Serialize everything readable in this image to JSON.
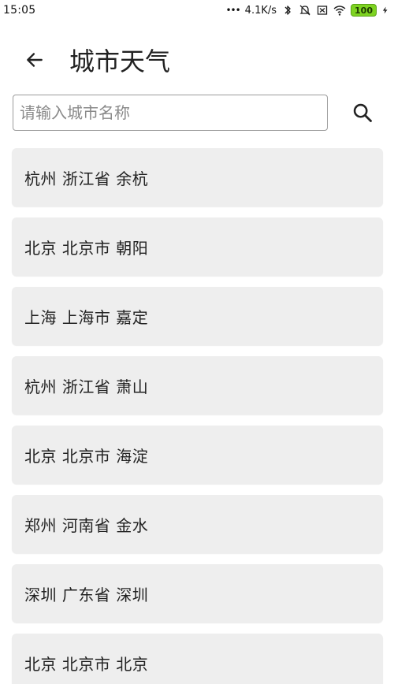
{
  "status_bar": {
    "time": "15:05",
    "network_speed": "4.1K/s",
    "battery": "100",
    "icons": [
      "dots-icon",
      "bluetooth-icon",
      "mute-icon",
      "sim-icon",
      "wifi-icon",
      "battery-icon",
      "charging-icon"
    ]
  },
  "header": {
    "title": "城市天气",
    "back_icon": "back-arrow-icon"
  },
  "search": {
    "placeholder": "请输入城市名称",
    "value": "",
    "button_icon": "search-icon"
  },
  "cities": [
    {
      "label": "杭州 浙江省 余杭"
    },
    {
      "label": "北京 北京市 朝阳"
    },
    {
      "label": "上海 上海市 嘉定"
    },
    {
      "label": "杭州 浙江省 萧山"
    },
    {
      "label": "北京 北京市 海淀"
    },
    {
      "label": "郑州 河南省 金水"
    },
    {
      "label": "深圳 广东省 深圳"
    },
    {
      "label": "北京 北京市 北京"
    }
  ],
  "colors": {
    "item_background": "#eeeeee",
    "battery": "#7ed321",
    "border": "#9b9b9b"
  }
}
